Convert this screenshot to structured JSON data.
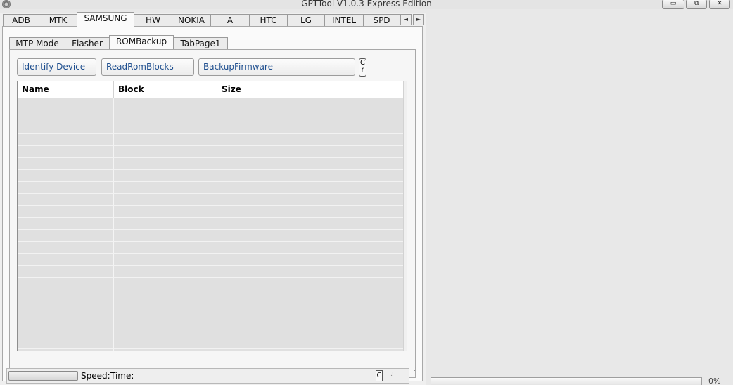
{
  "window": {
    "title": "GPTTool V1.0.3 Express Edition",
    "minimize_glyph": "▭",
    "restore_glyph": "⧉",
    "close_glyph": "✕"
  },
  "top_tabs": {
    "items": [
      "ADB",
      "MTK",
      "SAMSUNG",
      "HW",
      "NOKIA",
      "A",
      "HTC",
      "LG",
      "INTEL",
      "SPD"
    ],
    "active": "SAMSUNG",
    "scroll_left": "◄",
    "scroll_right": "►"
  },
  "samsung_tabs": {
    "items": [
      "MTP Mode",
      "Flasher",
      "ROMBackup",
      "TabPage1"
    ],
    "active": "ROMBackup"
  },
  "rom_backup": {
    "identify_button": "Identify Device",
    "read_blocks_button": "ReadRomBlocks",
    "backup_button": "BackupFirmware",
    "small_button": "C r"
  },
  "table": {
    "columns": [
      "Name",
      "Block",
      "Size"
    ],
    "rows": []
  },
  "status": {
    "speed_label": "Speed:",
    "time_label": "Time:",
    "c_button": "C",
    "grip": ".:"
  },
  "progress": {
    "percent": "0%",
    "value": 0
  },
  "colors": {
    "accent_text": "#1f4f8f",
    "grid_fill": "#e0e0e0"
  },
  "icons": {
    "app": "gear-icon",
    "grip": "resize-grip-icon"
  }
}
